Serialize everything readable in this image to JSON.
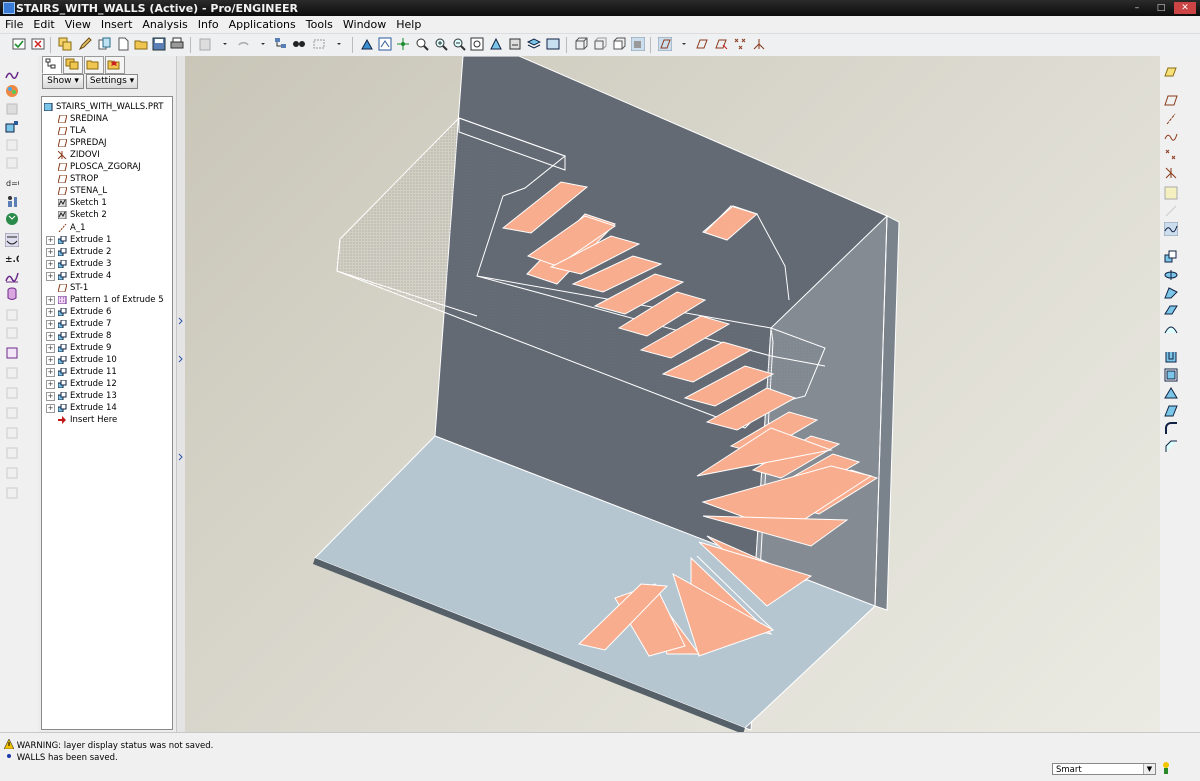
{
  "window": {
    "title": "STAIRS_WITH_WALLS (Active) - Pro/ENGINEER",
    "controls": [
      "–",
      "□",
      "✕"
    ]
  },
  "menu": [
    "File",
    "Edit",
    "View",
    "Insert",
    "Analysis",
    "Info",
    "Applications",
    "Tools",
    "Window",
    "Help"
  ],
  "nav": {
    "show_label": "Show",
    "settings_label": "Settings",
    "tree": [
      {
        "label": "STAIRS_WITH_WALLS.PRT",
        "icon": "part-icon",
        "expandable": false
      },
      {
        "label": "SREDINA",
        "icon": "datum-plane-icon",
        "expandable": false
      },
      {
        "label": "TLA",
        "icon": "datum-plane-icon",
        "expandable": false
      },
      {
        "label": "SPREDAJ",
        "icon": "datum-plane-icon",
        "expandable": false
      },
      {
        "label": "ZIDOVI",
        "icon": "csys-icon",
        "expandable": false
      },
      {
        "label": "PLOSCA_ZGORAJ",
        "icon": "datum-plane-icon",
        "expandable": false
      },
      {
        "label": "STROP",
        "icon": "datum-plane-icon",
        "expandable": false
      },
      {
        "label": "STENA_L",
        "icon": "datum-plane-icon",
        "expandable": false
      },
      {
        "label": "Sketch 1",
        "icon": "sketch-icon",
        "expandable": false
      },
      {
        "label": "Sketch 2",
        "icon": "sketch-icon",
        "expandable": false
      },
      {
        "label": "A_1",
        "icon": "datum-axis-icon",
        "expandable": false
      },
      {
        "label": "Extrude 1",
        "icon": "extrude-icon",
        "expandable": true
      },
      {
        "label": "Extrude 2",
        "icon": "extrude-icon",
        "expandable": true
      },
      {
        "label": "Extrude 3",
        "icon": "extrude-icon",
        "expandable": true
      },
      {
        "label": "Extrude 4",
        "icon": "extrude-icon",
        "expandable": true
      },
      {
        "label": "ST-1",
        "icon": "datum-plane-icon",
        "expandable": false
      },
      {
        "label": "Pattern 1 of Extrude 5",
        "icon": "pattern-icon",
        "expandable": true
      },
      {
        "label": "Extrude 6",
        "icon": "extrude-icon",
        "expandable": true
      },
      {
        "label": "Extrude 7",
        "icon": "extrude-icon",
        "expandable": true
      },
      {
        "label": "Extrude 8",
        "icon": "extrude-icon",
        "expandable": true
      },
      {
        "label": "Extrude 9",
        "icon": "extrude-icon",
        "expandable": true
      },
      {
        "label": "Extrude 10",
        "icon": "extrude-icon",
        "expandable": true
      },
      {
        "label": "Extrude 11",
        "icon": "extrude-icon",
        "expandable": true
      },
      {
        "label": "Extrude 12",
        "icon": "extrude-icon",
        "expandable": true
      },
      {
        "label": "Extrude 13",
        "icon": "extrude-icon",
        "expandable": true
      },
      {
        "label": "Extrude 14",
        "icon": "extrude-icon",
        "expandable": true
      },
      {
        "label": "Insert Here",
        "icon": "insert-arrow-icon",
        "expandable": false
      }
    ]
  },
  "status": {
    "messages": [
      {
        "icon": "warning-icon",
        "text": "WARNING: layer display status was not saved."
      },
      {
        "icon": "info-dot-icon",
        "text": "WALLS has been saved."
      }
    ],
    "filter_value": "Smart"
  },
  "colors": {
    "step_fill": "#f8ad8f",
    "wall": "#626872",
    "floor": "#b5c5d0",
    "background": "#d8d6cc"
  }
}
